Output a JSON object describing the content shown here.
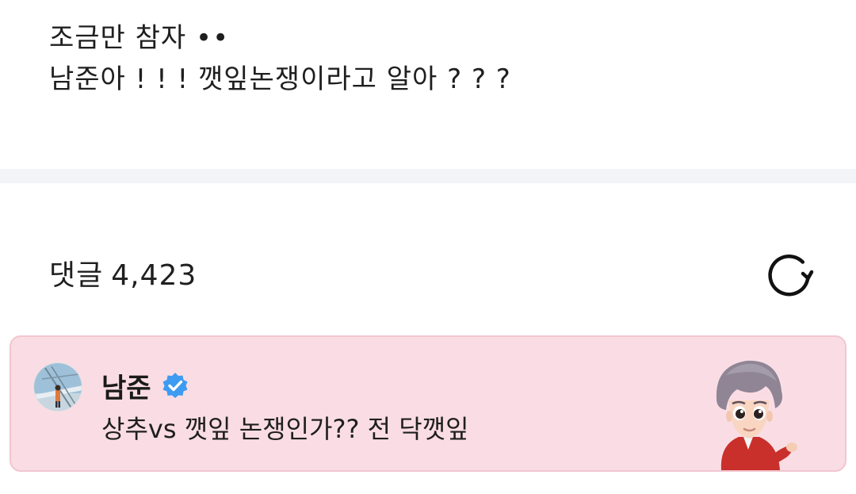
{
  "post": {
    "lines": [
      "조금만 참자 ••",
      "남준아 ! ! ! 깻잎논쟁이라고 알아 ? ? ?"
    ]
  },
  "comments": {
    "title": "댓글",
    "count": "4,423",
    "refresh_icon": "refresh-icon"
  },
  "artist_comment": {
    "author": "남준",
    "verified_icon": "verified-badge-icon",
    "text": "상추vs 깻잎 논쟁인가?? 전 닥깻잎",
    "colors": {
      "background": "#fadde4",
      "border": "#f2c6d0",
      "badge": "#3e9bf2"
    }
  }
}
